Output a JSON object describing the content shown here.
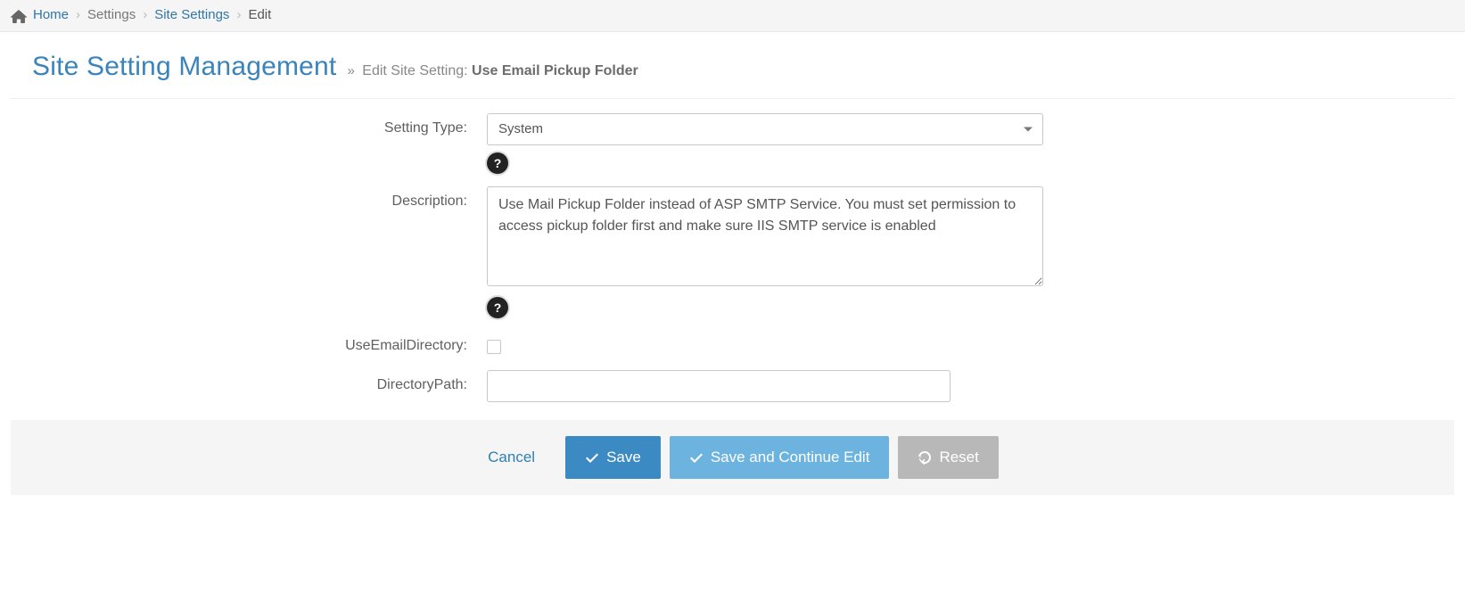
{
  "breadcrumb": {
    "home": "Home",
    "settings": "Settings",
    "site_settings": "Site Settings",
    "edit": "Edit"
  },
  "header": {
    "title": "Site Setting Management",
    "subtitle_prefix": "Edit Site Setting:",
    "subtitle_subject": "Use Email Pickup Folder"
  },
  "form": {
    "setting_type": {
      "label": "Setting Type:",
      "value": "System"
    },
    "description": {
      "label": "Description:",
      "value": "Use Mail Pickup Folder instead of ASP SMTP Service. You must set permission to access pickup folder first and make sure IIS SMTP service is enabled"
    },
    "use_email_directory": {
      "label": "UseEmailDirectory:",
      "checked": false
    },
    "directory_path": {
      "label": "DirectoryPath:",
      "value": ""
    }
  },
  "buttons": {
    "cancel": "Cancel",
    "save": "Save",
    "save_continue": "Save and Continue Edit",
    "reset": "Reset"
  }
}
